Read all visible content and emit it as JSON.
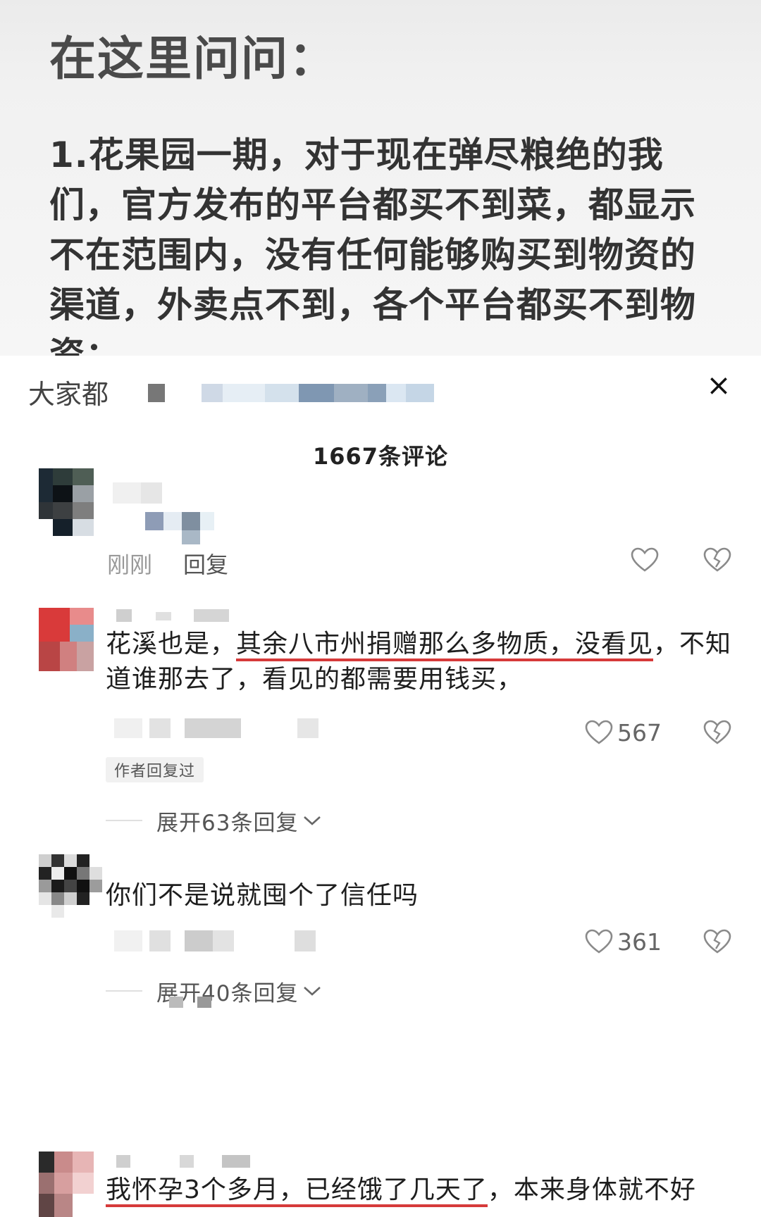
{
  "post": {
    "heading": "在这里问问：",
    "body": "1.花果园一期，对于现在弹尽粮绝的我们，官方发布的平台都买不到菜，都显示不在范围内，没有任何能够购买到物资的渠道，外卖点不到，各个平台都买不到物资："
  },
  "sheet": {
    "note_visible": "大家都",
    "close_label": "×",
    "comment_count_title": "1667条评论"
  },
  "comments": [
    {
      "time": "刚刚",
      "reply_label": "回复",
      "text": "",
      "like_count": ""
    },
    {
      "text_prefix": "花溪也是，",
      "text_highlight": "其余八市州捐赠那么多物质，没看见",
      "text_suffix": "，不知道谁那去了，看见的都需要用钱买，",
      "like_count": "567",
      "author_badge": "作者回复过",
      "expand_label": "展开63条回复"
    },
    {
      "text": "你们不是说就囤个了信任吗",
      "like_count": "361",
      "expand_label": "展开40条回复"
    },
    {
      "text_highlight": "我怀孕3个多月，已经饿了几天了",
      "text_suffix": "，本来身体就不好"
    }
  ],
  "icons": {
    "like": "heart-outline-icon",
    "dislike": "broken-heart-icon",
    "expand": "chevron-down-icon",
    "close": "close-icon"
  },
  "colors": {
    "highlight_underline": "#d63a3a",
    "meta_gray": "#999999"
  }
}
